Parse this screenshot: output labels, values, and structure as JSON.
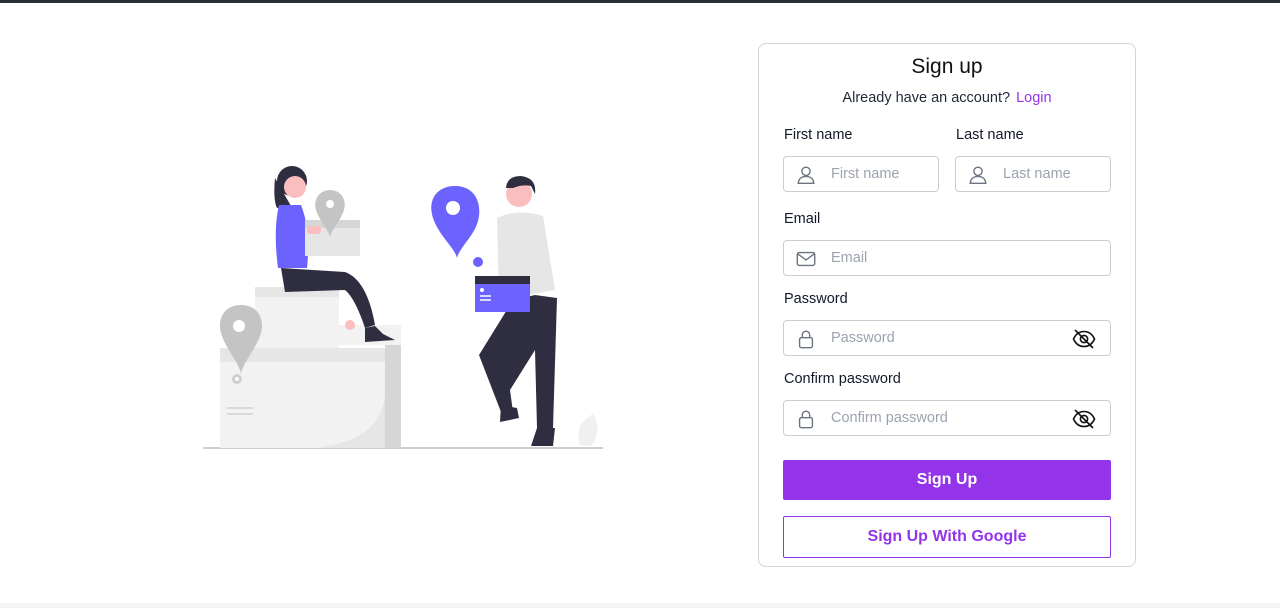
{
  "signup": {
    "title": "Sign up",
    "already_text": "Already have an account?",
    "login_link": "Login",
    "first_name": {
      "label": "First name",
      "placeholder": "First name"
    },
    "last_name": {
      "label": "Last name",
      "placeholder": "Last name"
    },
    "email": {
      "label": "Email",
      "placeholder": "Email"
    },
    "password": {
      "label": "Password",
      "placeholder": "Password"
    },
    "confirm_password": {
      "label": "Confirm password",
      "placeholder": "Confirm password"
    },
    "signup_button": "Sign Up",
    "google_button": "Sign Up With Google"
  },
  "colors": {
    "accent": "#9333ea",
    "illustration_purple": "#6c63ff",
    "dark": "#2f2e41"
  },
  "icons": [
    "user-icon",
    "mail-icon",
    "lock-icon",
    "eye-off-icon"
  ]
}
